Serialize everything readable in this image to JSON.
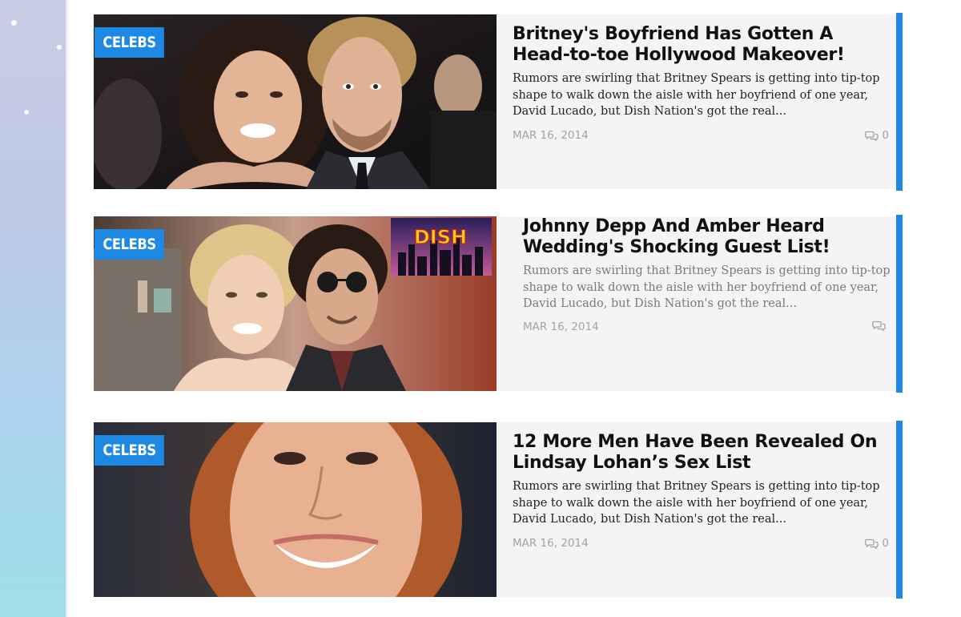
{
  "colors": {
    "accent": "#1e88e5",
    "card_bg": "#f4f4f4",
    "meta": "#a3a3a3"
  },
  "posts": [
    {
      "category": "CELEBS",
      "title": "Britney's Boyfriend Has Gotten A Head-to-toe Hollywood Makeover!",
      "excerpt": "Rumors are swirling that Britney Spears is getting into tip-top shape to walk down the aisle with her boyfriend of one year, David Lucado, but Dish Nation's got the real...",
      "date": "MAR 16, 2014",
      "comments": "0",
      "comment_icon": "speech-bubbles-icon"
    },
    {
      "category": "CELEBS",
      "title": "Johnny Depp And Amber Heard Wedding's Shocking Guest List!",
      "excerpt": "Rumors are swirling that Britney Spears is getting into tip-top shape to walk down the aisle with her boyfriend of one year, David Lucado, but Dish Nation's got the real...",
      "date": "MAR 16, 2014",
      "comments": "",
      "comment_icon": "speech-bubbles-icon",
      "image_logo": "DISH"
    },
    {
      "category": "CELEBS",
      "title": "12 More Men Have Been Revealed On Lindsay Lohan’s Sex List",
      "excerpt": "Rumors are swirling that Britney Spears is getting into tip-top shape to walk down the aisle with her boyfriend of one year, David Lucado, but Dish Nation's got the real...",
      "date": "MAR 16, 2014",
      "comments": "0",
      "comment_icon": "speech-bubbles-icon"
    }
  ]
}
